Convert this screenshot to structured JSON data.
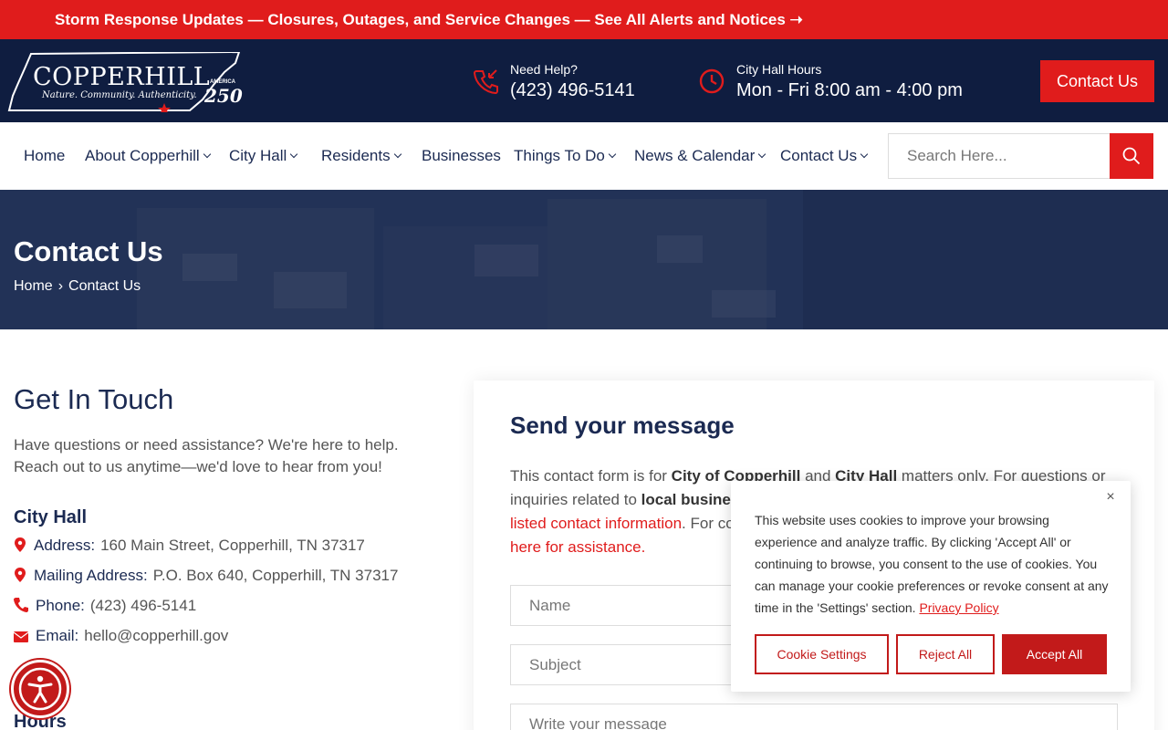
{
  "alert_bar": {
    "text": "Storm Response Updates — Closures, Outages, and Service Changes — See All Alerts and Notices ➝"
  },
  "header": {
    "logo": {
      "title": "COPPERHILL",
      "tagline": "Nature. Community. Authenticity.",
      "america": "AMERICA",
      "anniversary": "250"
    },
    "help": {
      "label": "Need Help?",
      "phone": "(423) 496-5141"
    },
    "hours": {
      "label": "City Hall Hours",
      "value": "Mon - Fri 8:00 am - 4:00 pm"
    },
    "contact_button": "Contact Us",
    "colors": {
      "navy": "#0f1d40",
      "red": "#e01c1c"
    }
  },
  "nav": {
    "items": [
      {
        "label": "Home",
        "dropdown": false
      },
      {
        "label": "About Copperhill",
        "dropdown": true
      },
      {
        "label": "City Hall",
        "dropdown": true
      },
      {
        "label": "Residents",
        "dropdown": true
      },
      {
        "label": "Businesses",
        "dropdown": false
      },
      {
        "label": "Things To Do",
        "dropdown": true
      },
      {
        "label": "News & Calendar",
        "dropdown": true
      },
      {
        "label": "Contact Us",
        "dropdown": true
      }
    ],
    "search_placeholder": "Search Here..."
  },
  "hero": {
    "title": "Contact Us",
    "breadcrumb": {
      "home": "Home",
      "separator": "›",
      "current": "Contact Us"
    }
  },
  "get_in_touch": {
    "title": "Get In Touch",
    "text": "Have questions or need assistance? We're here to help. Reach out to us anytime—we'd love to hear from you!",
    "city_hall_title": "City Hall",
    "address_label": "Address:",
    "address_value": "160 Main Street, Copperhill, TN 37317",
    "mailing_label": "Mailing Address:",
    "mailing_value": "P.O. Box 640, Copperhill, TN 37317",
    "phone_label": "Phone:",
    "phone_value": "(423) 496-5141",
    "email_label": "Email:",
    "email_value": "hello@copperhill.gov",
    "hours_title": "Hours"
  },
  "form": {
    "title": "Send your message",
    "text_1": "This contact form is for ",
    "text_b1": "City of Copperhill",
    "text_2": " and ",
    "text_b2": "City Hall",
    "text_3": " matters only. For questions or inquiries related to ",
    "text_b3": "local busines",
    "text_red1": "listed contact information",
    "text_4": ". For co",
    "text_red2": "here for assistance.",
    "name_placeholder": "Name",
    "subject_placeholder": "Subject",
    "message_placeholder": "Write your message"
  },
  "cookie": {
    "close": "×",
    "text": "This website uses cookies to improve your browsing experience and analyze traffic. By clicking 'Accept All' or continuing to browse, you consent to the use of cookies. You can manage your cookie preferences or revoke consent at any time in the 'Settings' section.",
    "policy_link": "Privacy Policy",
    "settings_button": "Cookie Settings",
    "reject_button": "Reject All",
    "accept_button": "Accept All"
  }
}
